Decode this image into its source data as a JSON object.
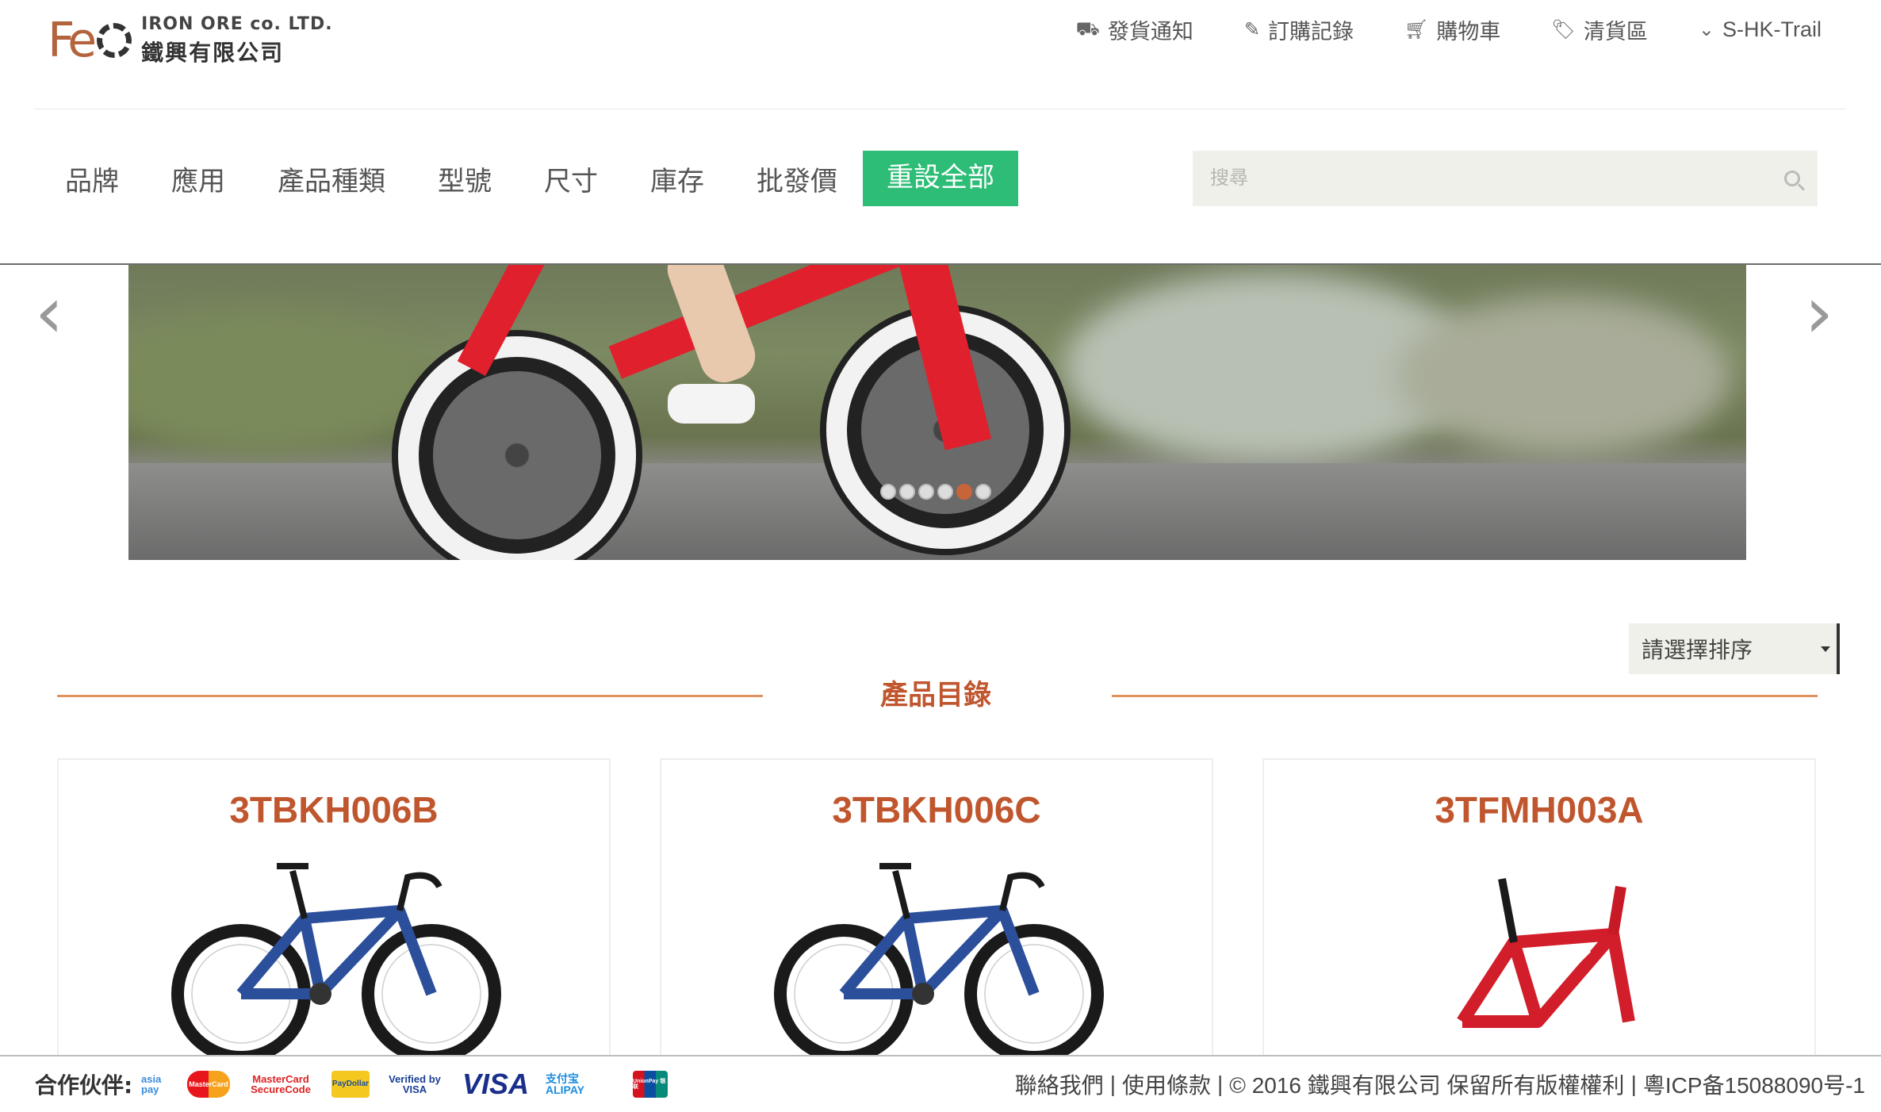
{
  "brand": {
    "logo_mark": "Fe",
    "name_en": "IRON ORE co. LTD.",
    "name_zh": "鐵興有限公司"
  },
  "top_links": [
    {
      "label": "發貨通知",
      "icon": "truck-icon"
    },
    {
      "label": "訂購記錄",
      "icon": "edit-icon"
    },
    {
      "label": "購物車",
      "icon": "cart-icon"
    },
    {
      "label": "清貨區",
      "icon": "tag-icon"
    },
    {
      "label": "S-HK-Trail",
      "icon": "chevron-down-icon"
    }
  ],
  "filters": [
    "品牌",
    "應用",
    "產品種類",
    "型號",
    "尺寸",
    "庫存",
    "批發價"
  ],
  "reset_label": "重設全部",
  "search": {
    "placeholder": "搜尋"
  },
  "carousel": {
    "slide_count": 6,
    "active_index": 4,
    "prev_glyph": "‹",
    "next_glyph": "›"
  },
  "sort": {
    "selected": "請選擇排序"
  },
  "section_title": "產品目錄",
  "products": [
    {
      "code": "3TBKH006B",
      "color": "#2c4f9c",
      "type": "bike"
    },
    {
      "code": "3TBKH006C",
      "color": "#2c4f9c",
      "type": "bike"
    },
    {
      "code": "3TFMH003A",
      "color": "#d21d2a",
      "type": "frame"
    }
  ],
  "footer": {
    "partners_label": "合作伙伴:",
    "partners": [
      "asia pay",
      "MasterCard",
      "MasterCard SecureCode",
      "PayDollar",
      "Verified by VISA",
      "VISA",
      "支付宝 ALIPAY",
      "UnionPay 银联"
    ],
    "links": [
      "聯絡我們",
      "使用條款",
      "© 2016 鐵興有限公司 保留所有版權權利",
      "粵ICP备15088090号-1"
    ]
  },
  "colors": {
    "accent": "#c0562e",
    "reset_green": "#2dbd76",
    "section_line": "#e0935e"
  }
}
